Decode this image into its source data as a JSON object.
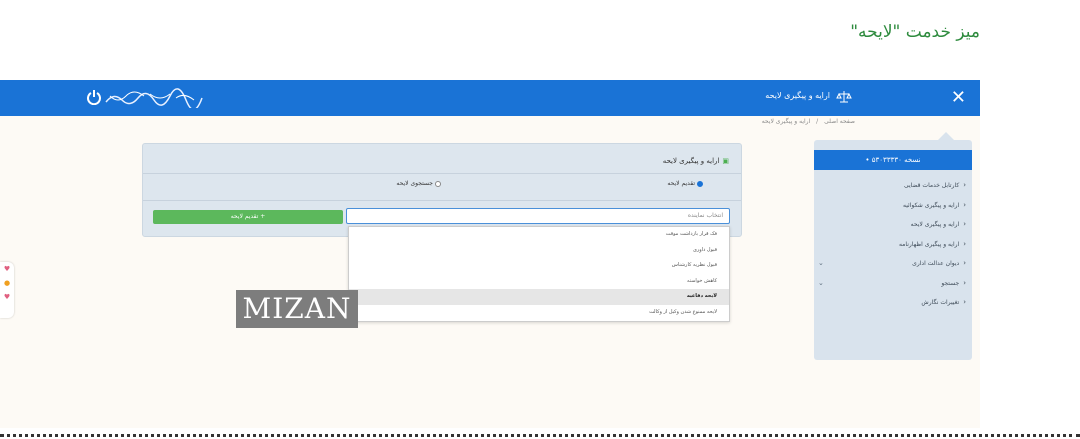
{
  "page_title": "میز خدمت \"لایحه\"",
  "topbar": {
    "app_title": "ارایه و پیگیری لایحه",
    "close_icon": "close-icon",
    "power_icon": "power-icon",
    "app_icon": "scales-icon"
  },
  "breadcrumb": [
    "صفحه اصلی",
    "/",
    "ارایه و پیگیری لایحه"
  ],
  "sidemenu": {
    "version": "نسخه ۵۳۰۳۳۳۳۰ •",
    "items": [
      {
        "label": "کارتابل خدمات قضایی",
        "has_down": false
      },
      {
        "label": "ارایه و پیگیری شکوائیه",
        "has_down": false
      },
      {
        "label": "ارایه و پیگیری لایحه",
        "has_down": false
      },
      {
        "label": "ارایه و پیگیری اظهارنامه",
        "has_down": false
      },
      {
        "label": "دیوان عدالت اداری",
        "has_down": true
      },
      {
        "label": "جستجو",
        "has_down": true
      },
      {
        "label": "تغییرات نگارش",
        "has_down": false
      }
    ]
  },
  "panel": {
    "header": "ارایه و پیگیری لایحه",
    "radio_submit": "تقدیم لایحه",
    "radio_search": "جستجوی لایحه",
    "submit_button": "+ تقدیم لایحه"
  },
  "dropdown": {
    "placeholder": "انتخاب نماینده",
    "options": [
      {
        "label": "فک قرار بازداشت موقت",
        "selected": false
      },
      {
        "label": "قبول داوری",
        "selected": false
      },
      {
        "label": "قبول نظریه کارشناس",
        "selected": false
      },
      {
        "label": "کاهش خواسته",
        "selected": false
      },
      {
        "label": "لایحه دفاعیه",
        "selected": true
      },
      {
        "label": "لایحه ممنوع شدن وکیل از وکالت",
        "selected": false
      }
    ]
  },
  "watermark": "MIZAN",
  "colors": {
    "primary": "#1a73d6",
    "accent_green": "#5cb85c",
    "title_green": "#2e8b3e"
  }
}
